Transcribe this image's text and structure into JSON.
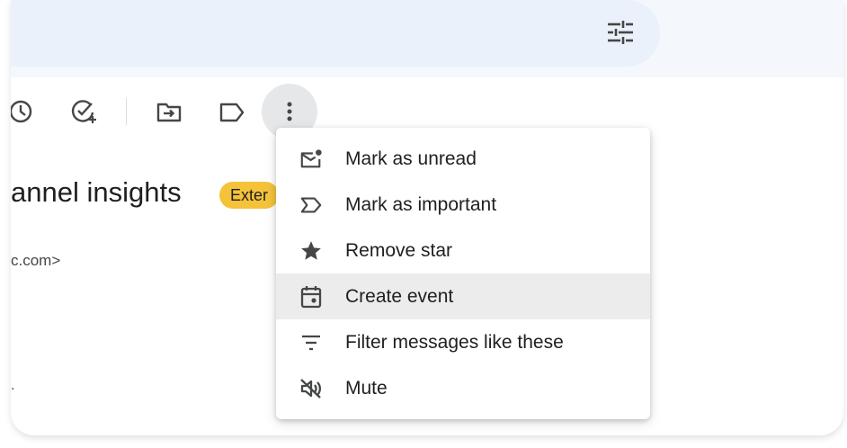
{
  "toolbar": {
    "icons": [
      "snooze-icon",
      "add-task-icon",
      "move-to-icon",
      "label-icon",
      "more-vert-icon"
    ]
  },
  "search": {
    "options_icon": "tune-icon"
  },
  "email": {
    "subject_fragment": "annel insights",
    "label_chip": "Exter",
    "sender_fragment": "c.com>",
    "stray_text": "."
  },
  "menu": {
    "items": [
      {
        "label": "Mark as unread",
        "icon": "mark-unread-icon"
      },
      {
        "label": "Mark as important",
        "icon": "important-icon"
      },
      {
        "label": "Remove star",
        "icon": "star-icon"
      },
      {
        "label": "Create event",
        "icon": "calendar-icon"
      },
      {
        "label": "Filter messages like these",
        "icon": "filter-icon"
      },
      {
        "label": "Mute",
        "icon": "mute-icon"
      }
    ],
    "hovered_index": 3
  },
  "colors": {
    "topbar_bg": "#f4f7fc",
    "search_bg": "#eaf1fb",
    "label_chip": "#f4c33a",
    "menu_hover": "#ececec",
    "icon": "#444746",
    "text": "#1f1f1f"
  }
}
